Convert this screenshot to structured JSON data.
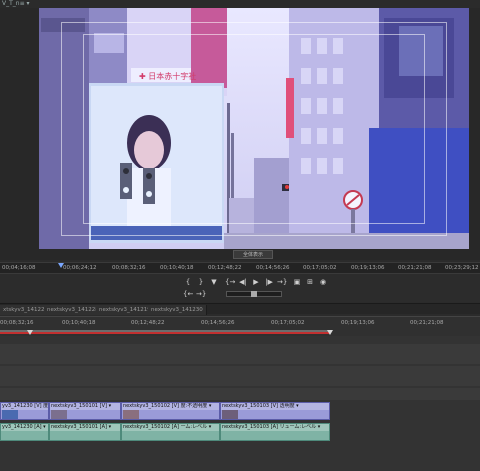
{
  "window": {
    "tab_title": "V_T_n≡ ▾"
  },
  "monitor": {
    "zoom_label": "全体表示"
  },
  "monitor_ruler": {
    "timecodes": [
      "00;04;16;08",
      "00;06;24;12",
      "00;08;32;16",
      "00;10;40;18",
      "00;12;48;22",
      "00;14;56;26",
      "00;17;05;02",
      "00;19;13;06",
      "00;21;21;08",
      "00;23;29;12"
    ]
  },
  "transport": {
    "row1": [
      "{",
      "}",
      "▼",
      "{→",
      "◀|",
      "◀",
      "▶",
      "|▶",
      "→}",
      "▣",
      "⊞",
      "◉"
    ],
    "row2": [
      "{←",
      "→}"
    ]
  },
  "sequence_tabs": [
    "xtskyv3_141226",
    "nextskyv3_141228",
    "nextskyv3_141219",
    "nextskyv3_141230"
  ],
  "timeline_ruler": {
    "timecodes": [
      "00;08;32;16",
      "00;10;40;18",
      "00;12;48;22",
      "00;14;56;26",
      "00;17;05;02",
      "00;19;13;06",
      "00;21;21;08"
    ]
  },
  "tracks": {
    "video": [
      "yv3_141230 [V] 度:不透明度",
      "nextskyv3_150101 [V] ▾",
      "nextskyv3_150102 [V] 度:不透明度 ▾",
      "nextskyv3_150103 [V] 透明度 ▾"
    ],
    "audio": [
      "yv3_141230 [A] ▾",
      "nextskyv3_150101 [A] ▾",
      "nextskyv3_150102 [A] ーム:レベル ▾",
      "nextskyv3_150103 [A] リューム:レベル ▾"
    ]
  },
  "colors": {
    "video_clip": "#9a9bd8",
    "audio_clip": "#7fb3a5",
    "playhead": "#7aa7ff",
    "timeline_marker": "#c23030"
  }
}
